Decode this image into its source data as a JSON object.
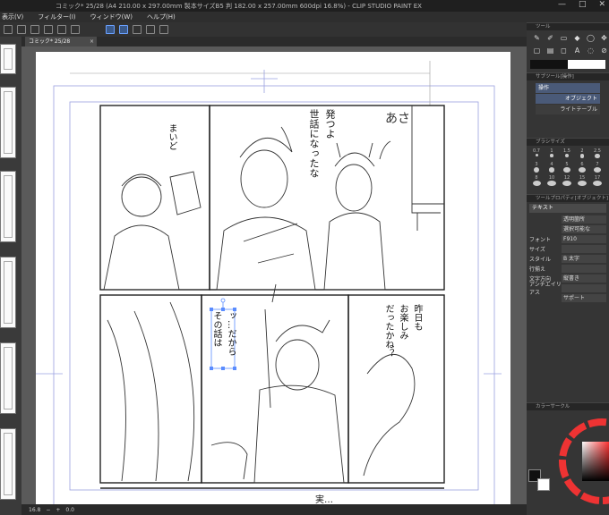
{
  "titlebar": {
    "title": "コミック* 25/28 (A4 210.00 x 297.00mm 製本サイズB5 判 182.00 x 257.00mm 600dpi 16.8%)  - CLIP STUDIO PAINT EX",
    "minimize": "—",
    "maximize": "□",
    "close": "✕"
  },
  "menu": {
    "items": [
      "表示(V)",
      "フィルター(I)",
      "ウィンドウ(W)",
      "ヘルプ(H)"
    ]
  },
  "tab": {
    "label": "コミック* 25/28",
    "close": "×"
  },
  "status": {
    "zoom": "16.8",
    "angle": "0.0"
  },
  "panels": {
    "tool_title": "ツール",
    "subtool_title": "サブツール[操作]",
    "subtool_items": [
      "操作",
      "オブジェクト",
      "ライトテーブル"
    ],
    "brush_title": "ブラシサイズ",
    "brush_sizes": [
      "0.7",
      "1",
      "1.5",
      "2",
      "2.5",
      "3",
      "4",
      "5",
      "6",
      "7",
      "8",
      "10",
      "12",
      "15",
      "17"
    ],
    "toolprop_title": "ツールプロパティ[オブジェクト]",
    "toolprop_header": "テキスト",
    "toolprop_rows": [
      {
        "label": "",
        "value": "透明箇所"
      },
      {
        "label": "",
        "value": "選択可能な"
      },
      {
        "label": "フォント",
        "value": "F910"
      },
      {
        "label": "サイズ",
        "value": ""
      },
      {
        "label": "スタイル",
        "value": "B 太字"
      },
      {
        "label": "行揃え",
        "value": ""
      },
      {
        "label": "文字方向",
        "value": "縦書き"
      },
      {
        "label": "アンチエイリアス",
        "value": ""
      },
      {
        "label": "",
        "value": "サポート"
      }
    ],
    "color_title": "カラーサークル"
  },
  "comic_text": {
    "bubble1": [
      "発つよ",
      "世話になったな"
    ],
    "bubble2": [
      "まいど"
    ],
    "bubble3": [
      "あさ"
    ],
    "bubble4": [
      "ッ…だから",
      "その話は"
    ],
    "bubble5": [
      "昨日も",
      "お楽しみ",
      "だったかね？"
    ],
    "bubble6": [
      "実…"
    ]
  },
  "colors": {
    "accent": "#6aa0ff",
    "main_color": "#111111",
    "sub_color": "#ffffff"
  }
}
